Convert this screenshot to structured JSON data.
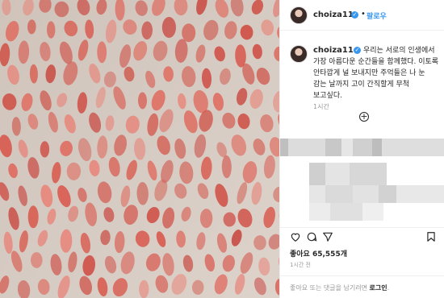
{
  "photo": {
    "description_icon": "abstract-paint-image"
  },
  "header": {
    "username": "choiza11",
    "verified_icon": "verified-badge-icon",
    "separator": "•",
    "follow_label": "팔로우"
  },
  "caption": {
    "username": "choiza11",
    "text": "우리는 서로의 인생에서 가장 아름다운 순간들을 함께했다. 이토록 안타깝게 널 보내지만 주억들은 나 눈 감는 날까지 고이 간직할게 무척 보고싶다.",
    "time": "1시간",
    "more_icon": "plus-circle-icon"
  },
  "actions": {
    "icons": [
      "heart-icon",
      "comment-icon",
      "share-icon",
      "bookmark-icon"
    ],
    "likes_label": "좋아요 65,555개",
    "time_label": "1시간 전"
  },
  "comment_bar": {
    "prompt": "좋아요 또는 댓글을 남기려면",
    "login_label": "로그인",
    "suffix": "."
  },
  "colors": {
    "accent": "#3897f0",
    "paint": "#d9574c"
  }
}
